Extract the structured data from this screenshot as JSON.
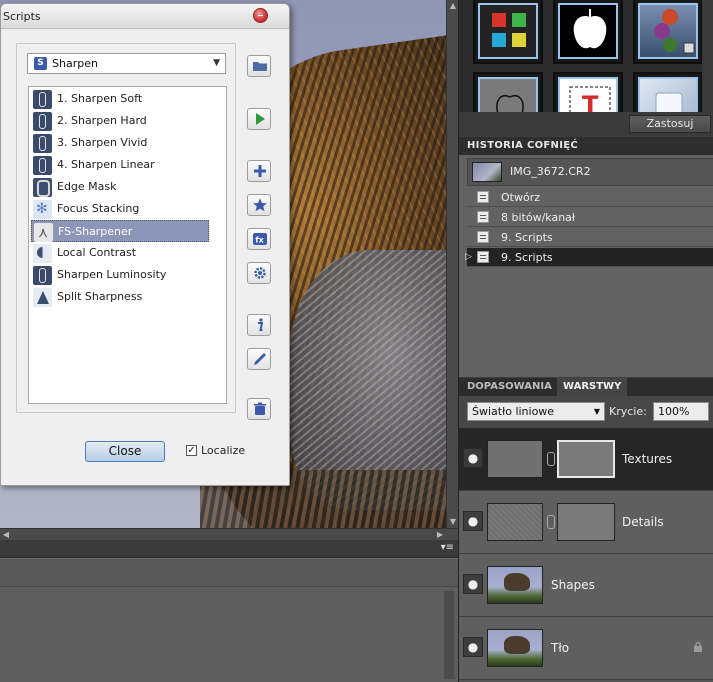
{
  "scripts_dialog": {
    "title": "Scripts",
    "selected_script": "Sharpen",
    "script_select_icon_letter": "S",
    "items": [
      {
        "label": "1. Sharpen Soft",
        "icon": "sharpen-icon"
      },
      {
        "label": "2. Sharpen Hard",
        "icon": "sharpen-icon"
      },
      {
        "label": "3. Sharpen Vivid",
        "icon": "sharpen-icon"
      },
      {
        "label": "4. Sharpen Linear",
        "icon": "sharpen-icon"
      },
      {
        "label": "Edge Mask",
        "icon": "edge-mask-icon"
      },
      {
        "label": "Focus Stacking",
        "icon": "focus-stacking-icon"
      },
      {
        "label": "FS-Sharpener",
        "icon": "fs-sharpener-icon"
      },
      {
        "label": "Local Contrast",
        "icon": "local-contrast-icon"
      },
      {
        "label": "Sharpen Luminosity",
        "icon": "sharpen-icon"
      },
      {
        "label": "Split Sharpness",
        "icon": "split-sharpness-icon"
      }
    ],
    "selected_index": 6,
    "side_buttons": [
      "folder-icon",
      "play-icon",
      "plus-icon",
      "star-icon",
      "fx-icon",
      "gear-icon",
      "info-icon",
      "pencil-icon",
      "trash-icon"
    ],
    "close_label": "Close",
    "localize_label": "Localize",
    "localize_checked": true,
    "checkmark": "✓"
  },
  "effects_panel": {
    "apply_label": "Zastosuj"
  },
  "history_panel": {
    "title": "HISTORIA COFNIĘĆ",
    "document_name": "IMG_3672.CR2",
    "items": [
      "Otwórz",
      "8 bitów/kanał",
      "9. Scripts",
      "9. Scripts"
    ],
    "active_index": 3,
    "active_marker": "▷"
  },
  "layers_panel": {
    "tabs": [
      "DOPASOWANIA",
      "WARSTWY"
    ],
    "active_tab": "WARSTWY",
    "blend_mode": "Światło liniowe",
    "opacity_label": "Krycie:",
    "opacity_value": "100%",
    "layers": [
      {
        "name": "Textures",
        "selected": true,
        "has_mask": true,
        "locked": false
      },
      {
        "name": "Details",
        "selected": false,
        "has_mask": true,
        "locked": false
      },
      {
        "name": "Shapes",
        "selected": false,
        "has_mask": false,
        "locked": false
      },
      {
        "name": "Tło",
        "selected": false,
        "has_mask": false,
        "locked": true
      }
    ],
    "eye_glyph": "●"
  },
  "glyphs": {
    "dropdown_arrow": "▼",
    "panel_menu": "▾≡",
    "scroll_up": "▲",
    "scroll_down": "▼",
    "scroll_left": "◀",
    "scroll_right": "▶"
  },
  "colors": {
    "selection": "#8c96b8",
    "close_button_border": "#4c7cb8",
    "dock_background": "#3d3d3d",
    "selected_layer": "#262626"
  }
}
